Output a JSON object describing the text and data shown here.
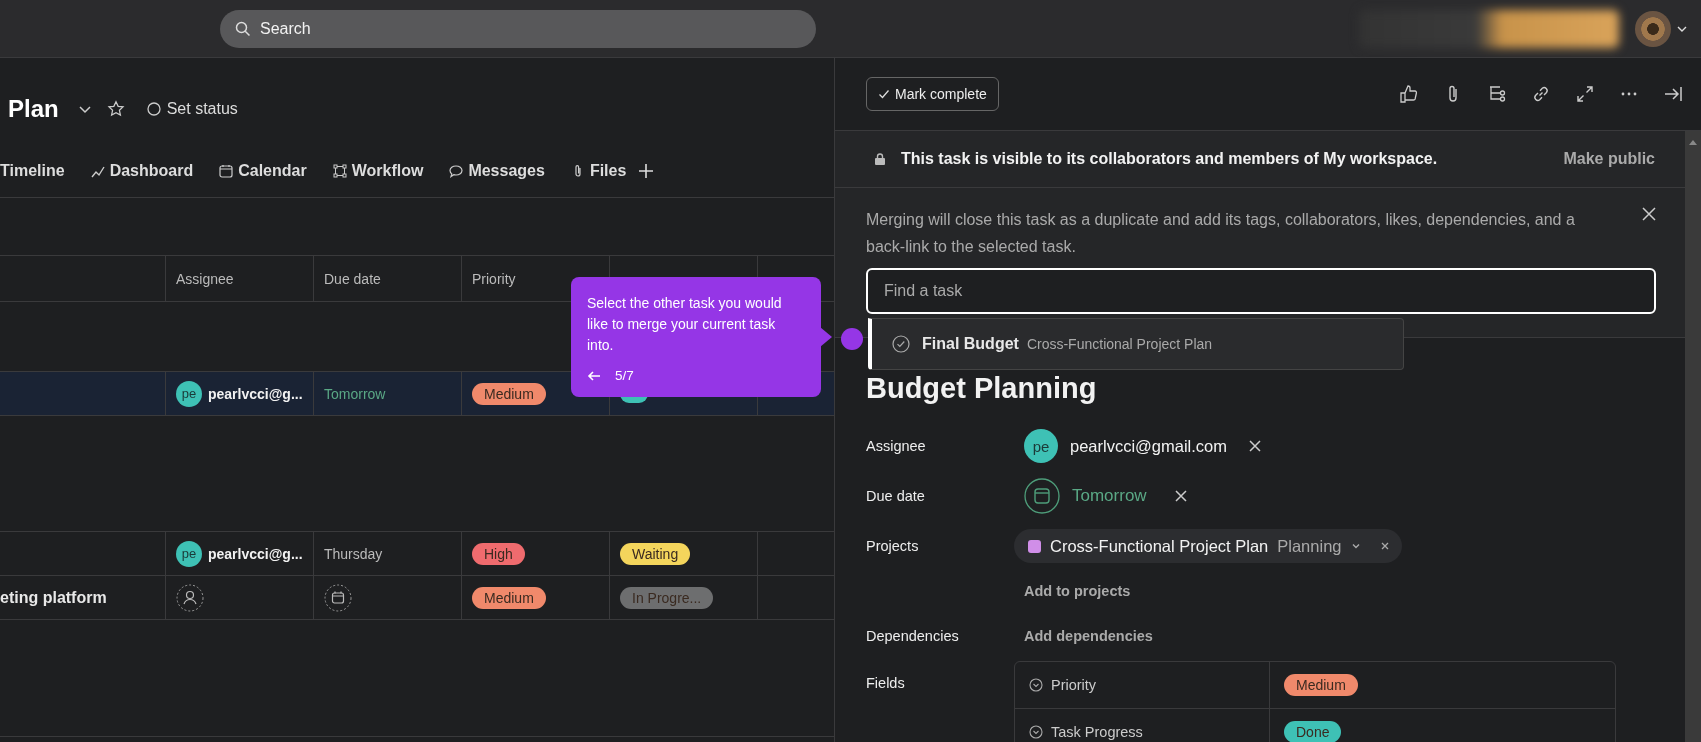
{
  "search": {
    "placeholder": "Search"
  },
  "project": {
    "title": "Plan",
    "status": "Set status"
  },
  "tabs": [
    {
      "label": "Timeline",
      "kind": "none"
    },
    {
      "label": "Dashboard",
      "kind": "chart"
    },
    {
      "label": "Calendar",
      "kind": "calendar"
    },
    {
      "label": "Workflow",
      "kind": "workflow"
    },
    {
      "label": "Messages",
      "kind": "message"
    },
    {
      "label": "Files",
      "kind": "clip"
    }
  ],
  "table": {
    "columns": [
      "Assignee",
      "Due date",
      "Priority"
    ],
    "sections": [
      {
        "rows": [
          {
            "name": null,
            "selected": true,
            "assignee": {
              "initials": "pe",
              "email": "pearlvcci@g..."
            },
            "due": {
              "text": "Tomorrow",
              "kind": "soon"
            },
            "priority": {
              "label": "Medium",
              "color": "#f0896b"
            },
            "progress": {
              "color": "#3ec1b5"
            }
          }
        ]
      },
      {
        "rows": [
          {
            "name": null,
            "selected": false,
            "assignee": {
              "initials": "pe",
              "email": "pearlvcci@g..."
            },
            "due": {
              "text": "Thursday",
              "kind": "plain"
            },
            "priority": {
              "label": "High",
              "color": "#ef6b6e"
            },
            "progress": {
              "label": "Waiting",
              "color": "#f4d55c"
            }
          },
          {
            "name": "eting platform",
            "selected": false,
            "assignee": null,
            "due": null,
            "priority": {
              "label": "Medium",
              "color": "#f0896b"
            },
            "progress": {
              "label": "In Progre...",
              "color": "#6d6e6f"
            }
          }
        ]
      }
    ]
  },
  "tooltip": {
    "text": "Select the other task you would like to merge your current task into.",
    "step": "5/7"
  },
  "panel": {
    "mark_complete": "Mark complete",
    "privacy": {
      "text": "This task is visible to its collaborators and members of My workspace.",
      "action": "Make public"
    },
    "merge": {
      "text": "Merging will close this task as a duplicate and add its tags, collaborators, likes, dependencies, and a back-link to the selected task.",
      "placeholder": "Find a task",
      "results": [
        {
          "title": "Final Budget",
          "project": "Cross-Functional Project Plan"
        }
      ]
    },
    "task": {
      "title": "Budget Planning",
      "labels": {
        "assignee": "Assignee",
        "due": "Due date",
        "projects": "Projects",
        "dependencies": "Dependencies",
        "fields": "Fields"
      },
      "assignee": {
        "initials": "pe",
        "email": "pearlvcci@gmail.com"
      },
      "due": "Tomorrow",
      "projects": [
        {
          "name": "Cross-Functional Project Plan",
          "section": "Planning",
          "color": "#d08ee8"
        }
      ],
      "add_project": "Add to projects",
      "add_dependency": "Add dependencies",
      "fields": [
        {
          "name": "Priority",
          "value": "Medium",
          "color": "#f0896b"
        },
        {
          "name": "Task Progress",
          "value": "Done",
          "color": "#3ec1b5"
        }
      ]
    }
  }
}
